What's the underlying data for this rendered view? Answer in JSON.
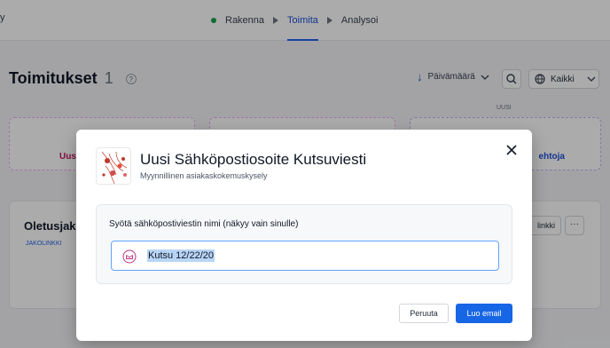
{
  "topnav": {
    "edge_glyph": "y",
    "steps": [
      {
        "label": "Rakenna"
      },
      {
        "label": "Toimita"
      },
      {
        "label": "Analysoi"
      }
    ],
    "active_step": "Toimita",
    "complete_color": "#16a34a",
    "active_color": "#1d4ed8"
  },
  "page": {
    "title": "Toimitukset",
    "count": "1",
    "help_icon": "question-icon",
    "sort_label": "Päivämäärä",
    "filter_label": "Kaikki",
    "new_badge": "UUSI",
    "card1_label": "Uus",
    "card3_label": "ehtoja"
  },
  "distribution": {
    "name": "Oletusjako",
    "tag": "JAKOLINKKI",
    "link_button": "linkki",
    "more_button": "···"
  },
  "modal": {
    "title": "Uusi Sähköpostiosoite Kutsuviesti",
    "subtitle": "Myynnillinen asiakaskokemuskysely",
    "field_label": "Syötä sähköpostiviestin nimi (näkyy vain sinulle)",
    "field_value": "Kutsu 12/22/20",
    "cancel_label": "Peruuta",
    "create_label": "Luo email",
    "primary_color": "#1766e5"
  }
}
